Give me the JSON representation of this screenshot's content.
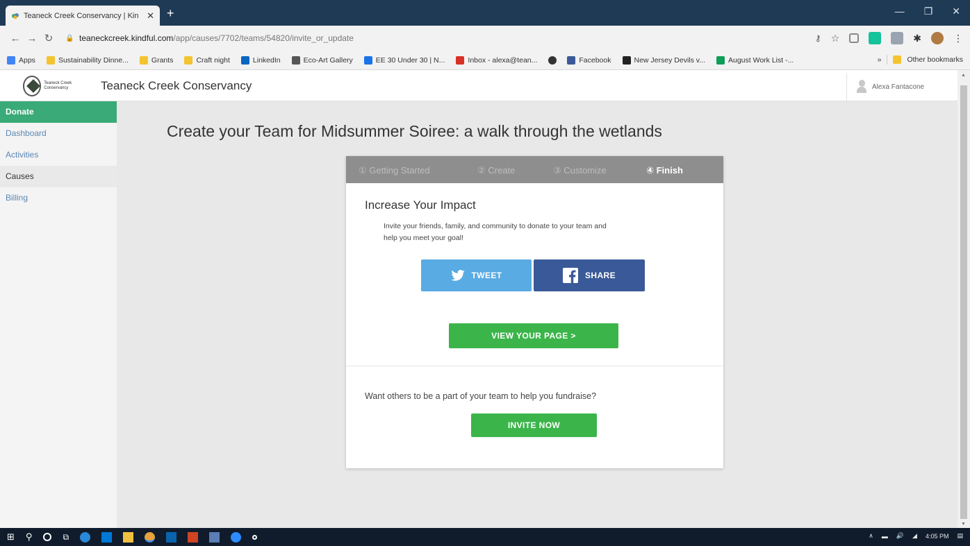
{
  "browser": {
    "tab_title": "Teaneck Creek Conservancy | Kin",
    "tab_close": "✕",
    "new_tab": "+",
    "url_domain": "teaneckcreek.kindful.com",
    "url_path": "/app/causes/7702/teams/54820/invite_or_update",
    "bookmarks": [
      {
        "label": "Apps",
        "color": "#4285f4"
      },
      {
        "label": "Sustainability Dinne...",
        "color": "#f4c430"
      },
      {
        "label": "Grants",
        "color": "#f4c430"
      },
      {
        "label": "Craft night",
        "color": "#f4c430"
      },
      {
        "label": "LinkedIn",
        "color": "#0a66c2"
      },
      {
        "label": "Eco-Art Gallery",
        "color": "#555555"
      },
      {
        "label": "EE 30 Under 30 | N...",
        "color": "#1a73e8"
      },
      {
        "label": "Inbox - alexa@tean...",
        "color": "#d93025"
      },
      {
        "label": "",
        "color": "#333333"
      },
      {
        "label": "Facebook",
        "color": "#3b5998"
      },
      {
        "label": "New Jersey Devils v...",
        "color": "#222222"
      },
      {
        "label": "August Work List -...",
        "color": "#0f9d58"
      }
    ],
    "other_bookmarks": "Other bookmarks",
    "more_bookmarks": "»"
  },
  "header": {
    "logo_text": "Teaneck Creek Conservancy",
    "org_name": "Teaneck Creek Conservancy",
    "user_name": "Alexa Fantacone"
  },
  "sidebar": {
    "items": [
      {
        "label": "Donate"
      },
      {
        "label": "Dashboard"
      },
      {
        "label": "Activities"
      },
      {
        "label": "Causes"
      },
      {
        "label": "Billing"
      }
    ]
  },
  "main": {
    "page_title": "Create your Team for Midsummer Soiree: a walk through the wetlands",
    "steps": [
      {
        "label": "① Getting Started"
      },
      {
        "label": "② Create"
      },
      {
        "label": "③ Customize"
      },
      {
        "label": "④ Finish"
      }
    ],
    "impact_title": "Increase Your Impact",
    "impact_text": "Invite your friends, family, and community to donate to your team and help you meet your goal!",
    "tweet_label": "TWEET",
    "share_label": "SHARE",
    "view_page_label": "VIEW YOUR PAGE >",
    "fundraise_text": "Want others to be a part of your team to help you fundraise?",
    "invite_label": "INVITE NOW"
  },
  "taskbar": {
    "time": "4:05 PM"
  },
  "colors": {
    "chrome_titlebar": "#1f3a55",
    "sidebar_active": "#3aaa78",
    "link_blue": "#5b87b4",
    "twitter": "#59abe3",
    "facebook": "#3a5998",
    "green_button": "#3bb54a",
    "steps_bar": "#8e8e8e"
  }
}
